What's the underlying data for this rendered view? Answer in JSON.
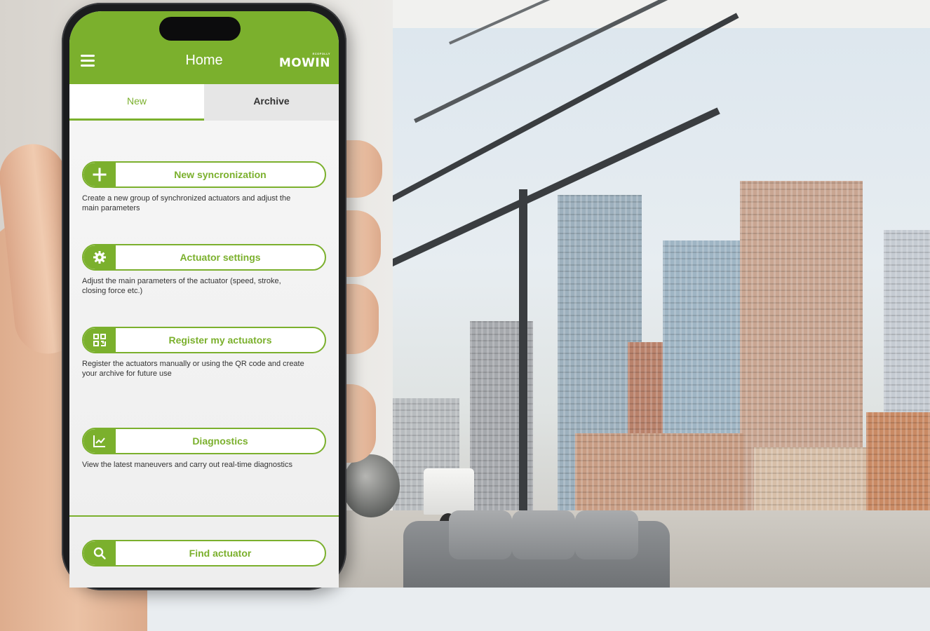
{
  "header": {
    "title": "Home",
    "brand_small": "ECOFOLLY",
    "brand_logo": "MOWIN",
    "menu_icon": "hamburger-menu-icon"
  },
  "tabs": [
    {
      "label": "New",
      "active": true
    },
    {
      "label": "Archive",
      "active": false
    }
  ],
  "actions": [
    {
      "icon": "plus-icon",
      "label": "New syncronization",
      "description": "Create a new group of synchronized actuators and adjust the main parameters"
    },
    {
      "icon": "gear-icon",
      "label": "Actuator settings",
      "description": "Adjust the main parameters of the actuator (speed, stroke, closing force etc.)"
    },
    {
      "icon": "qr-code-icon",
      "label": "Register my actuators",
      "description": "Register the actuators manually or using the QR code and create your archive for future use"
    },
    {
      "icon": "chart-icon",
      "label": "Diagnostics",
      "description": "View the latest maneuvers and carry out real-time diagnostics"
    },
    {
      "icon": "search-icon",
      "label": "Find actuator",
      "description": ""
    }
  ],
  "colors": {
    "accent": "#7bb02d",
    "tab_inactive_bg": "#e6e6e6",
    "screen_bg": "#f4f4f4"
  }
}
